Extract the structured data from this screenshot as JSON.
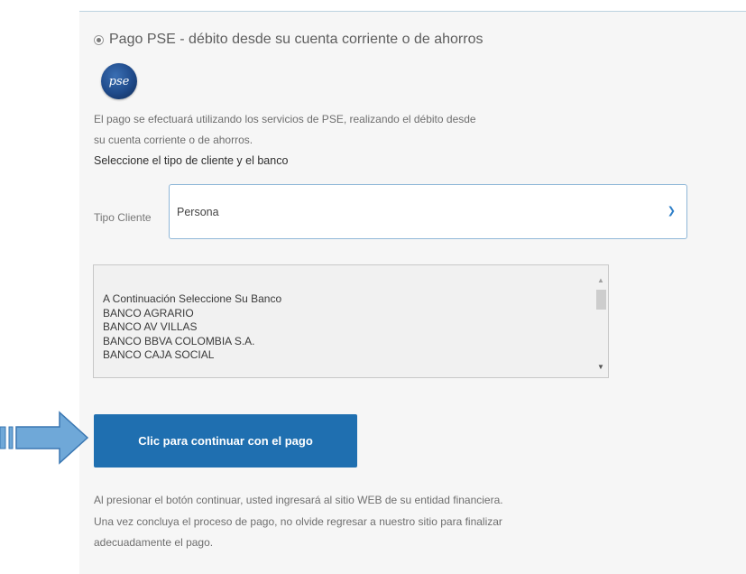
{
  "payment_option": {
    "label": "Pago PSE - débito desde su cuenta corriente o de ahorros",
    "selected": true,
    "logo_text": "pse"
  },
  "description": {
    "line1": "El pago se efectuará utilizando los servicios de PSE, realizando el débito desde",
    "line2": "su cuenta corriente o de ahorros."
  },
  "select_title": "Seleccione el tipo de cliente y el banco",
  "tipo_cliente": {
    "label": "Tipo Cliente",
    "value": "Persona"
  },
  "bank_list": {
    "items": [
      "A Continuación Seleccione Su Banco",
      "BANCO AGRARIO",
      "BANCO AV VILLAS",
      "BANCO BBVA COLOMBIA S.A.",
      "BANCO CAJA SOCIAL"
    ]
  },
  "continue_button": "Clic para continuar con el pago",
  "footer": {
    "line1": "Al presionar el botón continuar, usted ingresará al sitio WEB de su entidad financiera.",
    "line2": "Una vez concluya el proceso de pago, no olvide regresar a nuestro sitio para finalizar",
    "line3": "adecuadamente el pago."
  },
  "colors": {
    "button": "#1f6fb0",
    "arrow": "#6fa8d8",
    "select_border": "#8fb7d8"
  }
}
